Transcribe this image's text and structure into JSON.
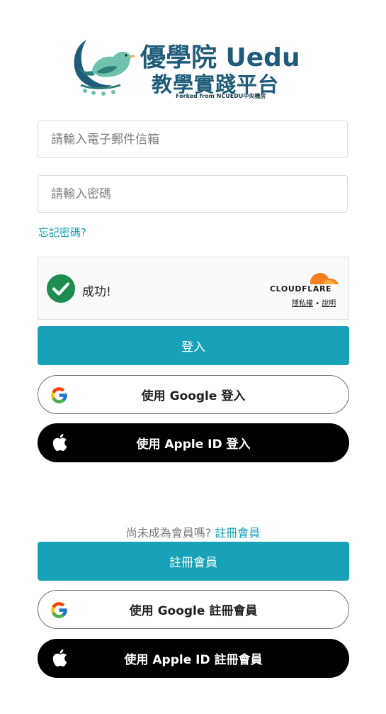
{
  "logo": {
    "title": "優學院 Uedu",
    "subtitle": "教學實踐平台",
    "forked_note": "Forked from NCUEDU中央機房"
  },
  "login_form": {
    "email_placeholder": "請輸入電子郵件信箱",
    "password_placeholder": "請輸入密碼",
    "forgot_password": "忘記密碼?"
  },
  "captcha": {
    "status": "成功!",
    "provider": "CLOUDFLARE",
    "privacy_link": "隱私權",
    "separator": "•",
    "help_link": "說明",
    "colors": {
      "check": "#1e8c4e",
      "cloud": "#f48120"
    }
  },
  "buttons": {
    "login": "登入",
    "google_login": "使用 Google 登入",
    "apple_login": "使用 Apple ID 登入",
    "signup": "註冊會員",
    "google_signup": "使用 Google 註冊會員",
    "apple_signup": "使用 Apple ID 註冊會員"
  },
  "signup_prompt": {
    "text": "尚未成為會員嗎?",
    "link": "註冊會員"
  },
  "colors": {
    "accent": "#17a2b8",
    "brand_text": "#1f5c7a"
  },
  "icons": {
    "logo": "bird-logo-icon",
    "google": "google-icon",
    "apple": "apple-icon",
    "check": "check-icon",
    "cloudflare": "cloudflare-cloud-icon"
  }
}
